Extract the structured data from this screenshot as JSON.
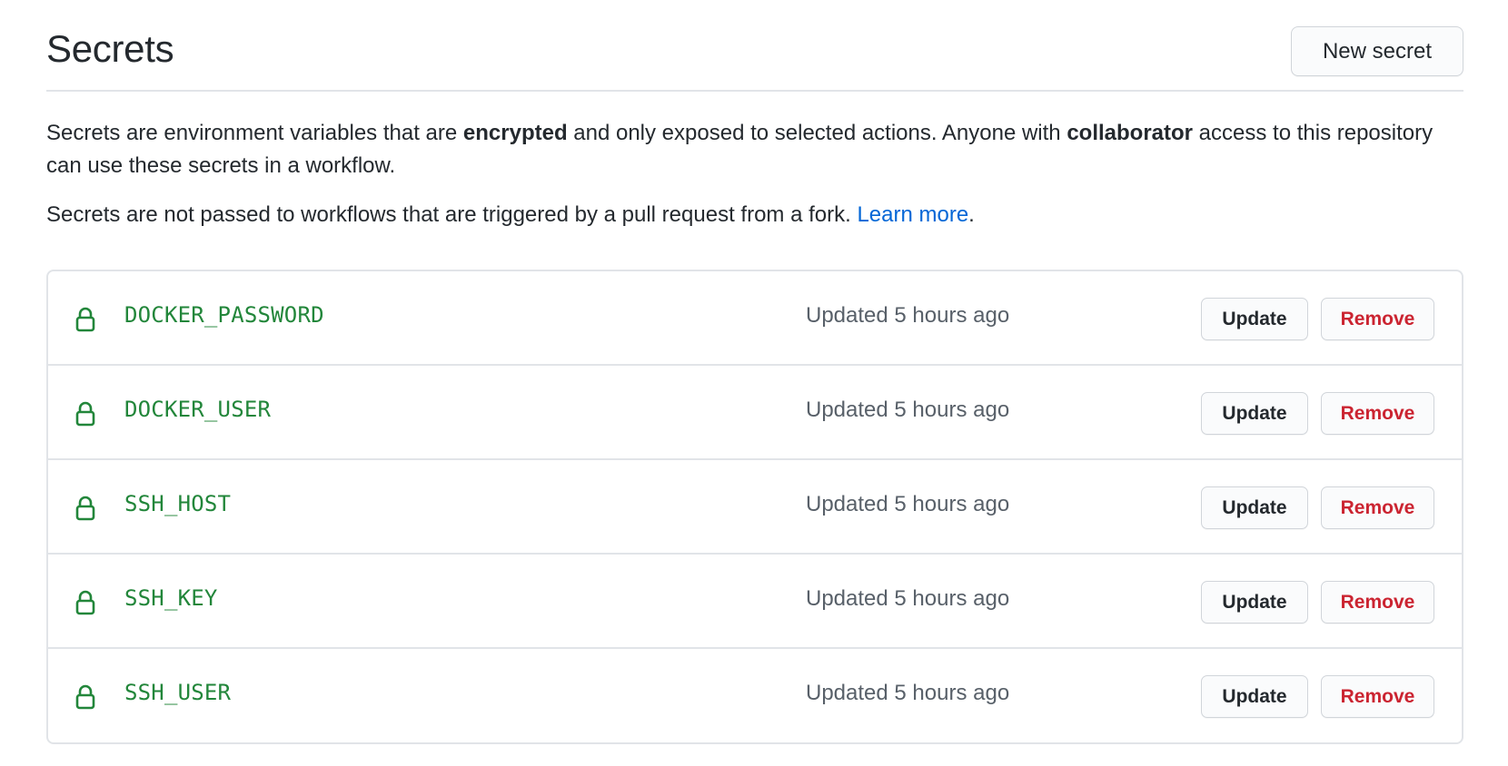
{
  "header": {
    "title": "Secrets",
    "new_secret_label": "New secret"
  },
  "description": {
    "line1_part1": "Secrets are environment variables that are ",
    "line1_bold1": "encrypted",
    "line1_part2": " and only exposed to selected actions. Anyone with ",
    "line1_bold2": "collaborator",
    "line1_part3": " access to this repository can use these secrets in a workflow.",
    "line2_text": "Secrets are not passed to workflows that are triggered by a pull request from a fork. ",
    "line2_link": "Learn more",
    "line2_end": "."
  },
  "secrets": [
    {
      "name": "DOCKER_PASSWORD",
      "updated": "Updated 5 hours ago",
      "update_label": "Update",
      "remove_label": "Remove"
    },
    {
      "name": "DOCKER_USER",
      "updated": "Updated 5 hours ago",
      "update_label": "Update",
      "remove_label": "Remove"
    },
    {
      "name": "SSH_HOST",
      "updated": "Updated 5 hours ago",
      "update_label": "Update",
      "remove_label": "Remove"
    },
    {
      "name": "SSH_KEY",
      "updated": "Updated 5 hours ago",
      "update_label": "Update",
      "remove_label": "Remove"
    },
    {
      "name": "SSH_USER",
      "updated": "Updated 5 hours ago",
      "update_label": "Update",
      "remove_label": "Remove"
    }
  ],
  "icons": {
    "row_icon": "lock-icon"
  },
  "colors": {
    "secret_name": "#22863a",
    "link": "#0366d6",
    "remove": "#cb2431",
    "muted": "#586069"
  }
}
